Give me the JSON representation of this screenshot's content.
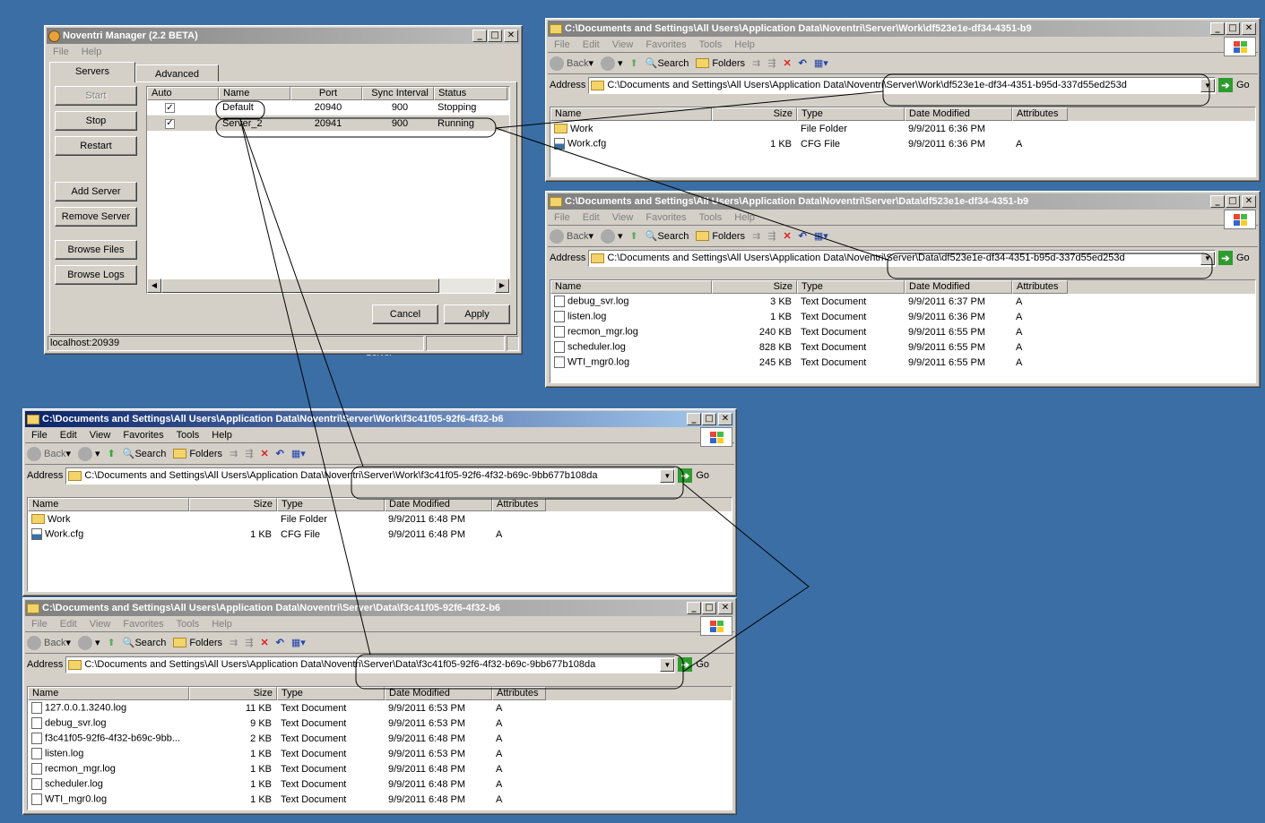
{
  "manager": {
    "title": "Noventri Manager (2.2 BETA)",
    "menu": [
      "File",
      "Help"
    ],
    "tabs": [
      "Servers",
      "Advanced"
    ],
    "buttons": {
      "start": "Start",
      "stop": "Stop",
      "restart": "Restart",
      "add_server": "Add Server",
      "remove_server": "Remove Server",
      "browse_files": "Browse Files",
      "browse_logs": "Browse Logs",
      "cancel": "Cancel",
      "apply": "Apply"
    },
    "columns": [
      "Auto",
      "Name",
      "Port",
      "Sync Interval",
      "Status"
    ],
    "servers": [
      {
        "auto": "✓",
        "name": "Default",
        "port": "20940",
        "interval": "900",
        "status": "Stopping"
      },
      {
        "auto": "✓",
        "name": "Server_2",
        "port": "20941",
        "interval": "900",
        "status": "Running"
      }
    ],
    "statusbar": "localhost:20939"
  },
  "explorer_common": {
    "menu": [
      "File",
      "Edit",
      "View",
      "Favorites",
      "Tools",
      "Help"
    ],
    "back": "Back",
    "search": "Search",
    "folders": "Folders",
    "address_label": "Address",
    "go": "Go",
    "columns": [
      "Name",
      "Size",
      "Type",
      "Date Modified",
      "Attributes"
    ]
  },
  "explorer1": {
    "title": "C:\\Documents and Settings\\All Users\\Application Data\\Noventri\\Server\\Work\\df523e1e-df34-4351-b9",
    "address": "C:\\Documents and Settings\\All Users\\Application Data\\Noventri\\Server\\Work\\df523e1e-df34-4351-b95d-337d55ed253d",
    "files": [
      {
        "name": "Work",
        "size": "",
        "type": "File Folder",
        "date": "9/9/2011 6:36 PM",
        "attr": "",
        "icon": "folder"
      },
      {
        "name": "Work.cfg",
        "size": "1 KB",
        "type": "CFG File",
        "date": "9/9/2011 6:36 PM",
        "attr": "A",
        "icon": "cfg"
      }
    ]
  },
  "explorer2": {
    "title": "C:\\Documents and Settings\\All Users\\Application Data\\Noventri\\Server\\Data\\df523e1e-df34-4351-b9",
    "address": "C:\\Documents and Settings\\All Users\\Application Data\\Noventri\\Server\\Data\\df523e1e-df34-4351-b95d-337d55ed253d",
    "files": [
      {
        "name": "debug_svr.log",
        "size": "3 KB",
        "type": "Text Document",
        "date": "9/9/2011 6:37 PM",
        "attr": "A",
        "icon": "doc"
      },
      {
        "name": "listen.log",
        "size": "1 KB",
        "type": "Text Document",
        "date": "9/9/2011 6:36 PM",
        "attr": "A",
        "icon": "doc"
      },
      {
        "name": "recmon_mgr.log",
        "size": "240 KB",
        "type": "Text Document",
        "date": "9/9/2011 6:55 PM",
        "attr": "A",
        "icon": "doc"
      },
      {
        "name": "scheduler.log",
        "size": "828 KB",
        "type": "Text Document",
        "date": "9/9/2011 6:55 PM",
        "attr": "A",
        "icon": "doc"
      },
      {
        "name": "WTI_mgr0.log",
        "size": "245 KB",
        "type": "Text Document",
        "date": "9/9/2011 6:55 PM",
        "attr": "A",
        "icon": "doc"
      }
    ]
  },
  "explorer3": {
    "title": "C:\\Documents and Settings\\All Users\\Application Data\\Noventri\\Server\\Work\\f3c41f05-92f6-4f32-b6",
    "address": "C:\\Documents and Settings\\All Users\\Application Data\\Noventri\\Server\\Work\\f3c41f05-92f6-4f32-b69c-9bb677b108da",
    "files": [
      {
        "name": "Work",
        "size": "",
        "type": "File Folder",
        "date": "9/9/2011 6:48 PM",
        "attr": "",
        "icon": "folder"
      },
      {
        "name": "Work.cfg",
        "size": "1 KB",
        "type": "CFG File",
        "date": "9/9/2011 6:48 PM",
        "attr": "A",
        "icon": "cfg"
      }
    ]
  },
  "explorer4": {
    "title": "C:\\Documents and Settings\\All Users\\Application Data\\Noventri\\Server\\Data\\f3c41f05-92f6-4f32-b6",
    "address": "C:\\Documents and Settings\\All Users\\Application Data\\Noventri\\Server\\Data\\f3c41f05-92f6-4f32-b69c-9bb677b108da",
    "files": [
      {
        "name": "127.0.0.1.3240.log",
        "size": "11 KB",
        "type": "Text Document",
        "date": "9/9/2011 6:53 PM",
        "attr": "A",
        "icon": "doc"
      },
      {
        "name": "debug_svr.log",
        "size": "9 KB",
        "type": "Text Document",
        "date": "9/9/2011 6:53 PM",
        "attr": "A",
        "icon": "doc"
      },
      {
        "name": "f3c41f05-92f6-4f32-b69c-9bb...",
        "size": "2 KB",
        "type": "Text Document",
        "date": "9/9/2011 6:48 PM",
        "attr": "A",
        "icon": "doc"
      },
      {
        "name": "listen.log",
        "size": "1 KB",
        "type": "Text Document",
        "date": "9/9/2011 6:53 PM",
        "attr": "A",
        "icon": "doc"
      },
      {
        "name": "recmon_mgr.log",
        "size": "1 KB",
        "type": "Text Document",
        "date": "9/9/2011 6:48 PM",
        "attr": "A",
        "icon": "doc"
      },
      {
        "name": "scheduler.log",
        "size": "1 KB",
        "type": "Text Document",
        "date": "9/9/2011 6:48 PM",
        "attr": "A",
        "icon": "doc"
      },
      {
        "name": "WTI_mgr0.log",
        "size": "1 KB",
        "type": "Text Document",
        "date": "9/9/2011 6:48 PM",
        "attr": "A",
        "icon": "doc"
      }
    ]
  },
  "desktop_label": "Server",
  "colors": {
    "desktop": "#3a6ea5",
    "active_title": "#0a246a",
    "inactive_title": "#808080"
  }
}
